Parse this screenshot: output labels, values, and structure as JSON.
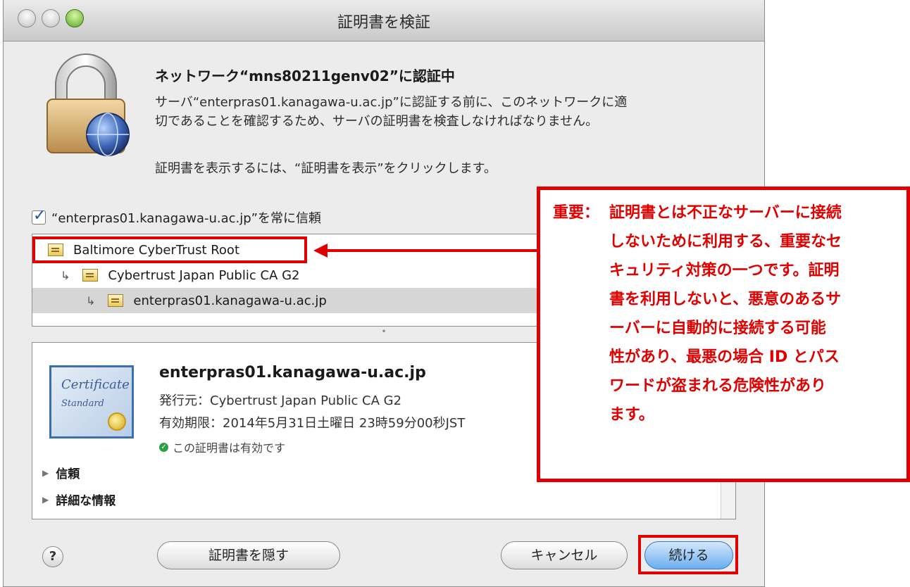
{
  "window": {
    "title": "証明書を検証"
  },
  "message": {
    "heading": "ネットワーク“mns80211genv02”に認証中",
    "line1": "サーバ“enterpras01.kanagawa-u.ac.jp”に認証する前に、このネットワークに適",
    "line2": "切であることを確認するため、サーバの証明書を検査しなければなりません。",
    "line3": "証明書を表示するには、“証明書を表示”をクリックします。"
  },
  "trust_checkbox": {
    "label": "“enterpras01.kanagawa-u.ac.jp”を常に信頼",
    "checked": true
  },
  "cert_chain": [
    {
      "name": "Baltimore CyberTrust Root"
    },
    {
      "name": "Cybertrust Japan Public CA G2"
    },
    {
      "name": "enterpras01.kanagawa-u.ac.jp"
    }
  ],
  "cert_detail": {
    "image_text_1": "Certificate",
    "image_text_2": "Standard",
    "common_name": "enterpras01.kanagawa-u.ac.jp",
    "issuer": "発行元：Cybertrust Japan Public CA G2",
    "expiry": "有効期限：2014年5月31日土曜日 23時59分00秒JST",
    "valid_text": "この証明書は有効です",
    "sections": [
      "信頼",
      "詳細な情報"
    ]
  },
  "buttons": {
    "help": "?",
    "hide": "証明書を隠す",
    "cancel": "キャンセル",
    "continue": "続ける"
  },
  "annotation": {
    "lead": "重要：",
    "lines": [
      "証明書とは不正なサーバーに接続",
      "しないために利用する、重要なセ",
      "キュリティ対策の一つです。証明",
      "書を利用しないと、悪意のあるサ",
      "ーバーに自動的に接続する可能",
      "性があり、最悪の場合 ID とパス",
      "ワードが盗まれる危険性があり",
      "ます。"
    ],
    "color": "#e00000"
  }
}
